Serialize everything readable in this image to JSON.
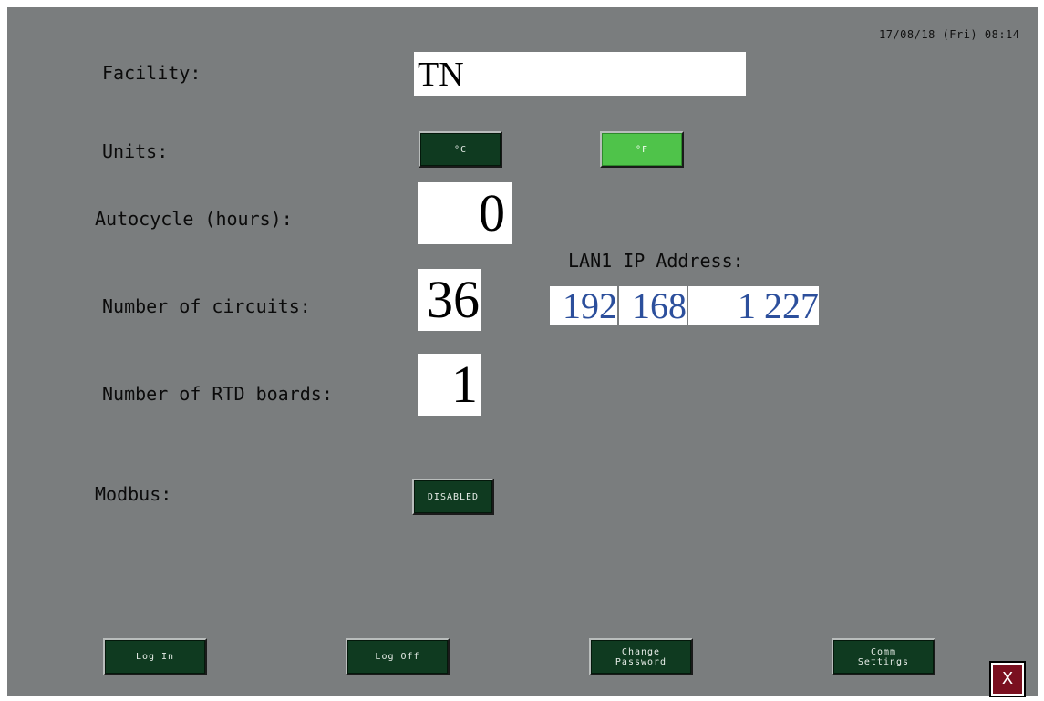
{
  "status": {
    "datetime": "17/08/18 (Fri) 08:14"
  },
  "facility": {
    "label": "Facility:",
    "value": "TN"
  },
  "units": {
    "label": "Units:",
    "celsius_label": "°C",
    "fahrenheit_label": "°F",
    "selected": "°F"
  },
  "autocycle": {
    "label": "Autocycle (hours):",
    "value": "0"
  },
  "circuits": {
    "label": "Number of circuits:",
    "value": "36"
  },
  "rtd_boards": {
    "label": "Number of RTD boards:",
    "value": "1"
  },
  "lan": {
    "label": "LAN1 IP Address:",
    "octets": [
      "192",
      "168",
      "1",
      "227"
    ]
  },
  "modbus": {
    "label": "Modbus:",
    "button_label": "DISABLED"
  },
  "footer": {
    "login_label": "Log In",
    "logoff_label": "Log Off",
    "change_password_label": "Change\nPassword",
    "comm_settings_label": "Comm\nSettings"
  },
  "close": {
    "icon": "close-icon",
    "glyph": "X"
  },
  "colors": {
    "background": "#7a7d7e",
    "button_dark": "#0f3a20",
    "button_active": "#4fc34a",
    "ip_text": "#2c4f9c",
    "close_button": "#7a1020"
  }
}
